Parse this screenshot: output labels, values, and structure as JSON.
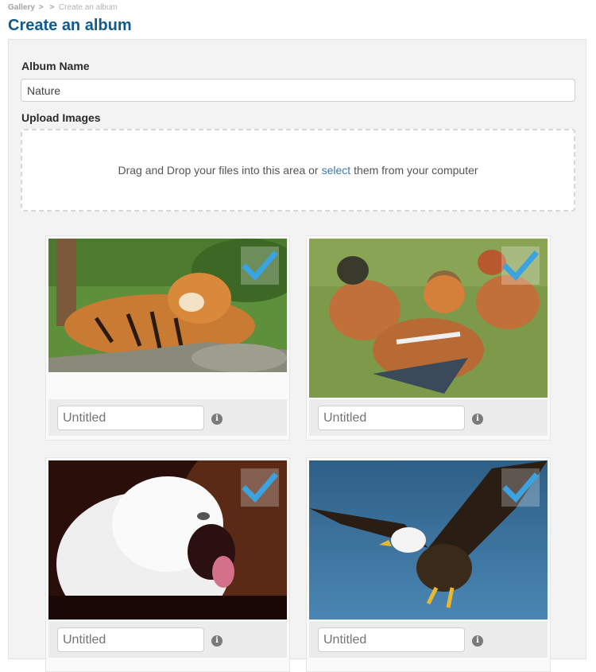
{
  "breadcrumb": {
    "root": "Gallery",
    "separator": ">",
    "current": "Create an album"
  },
  "page_title": "Create an album",
  "form": {
    "album_name_label": "Album Name",
    "album_name_value": "Nature",
    "upload_label": "Upload Images",
    "dropzone": {
      "text_before": "Drag and Drop your files into this area or",
      "link_text": "select",
      "text_after": "them from your computer"
    }
  },
  "images": [
    {
      "subject": "tigers",
      "title_placeholder": "Untitled",
      "selected": true,
      "info_icon": "info-icon",
      "check_icon": "checkmark-icon"
    },
    {
      "subject": "mandarin ducks",
      "title_placeholder": "Untitled",
      "selected": true,
      "info_icon": "info-icon",
      "check_icon": "checkmark-icon"
    },
    {
      "subject": "white lion",
      "title_placeholder": "Untitled",
      "selected": true,
      "info_icon": "info-icon",
      "check_icon": "checkmark-icon"
    },
    {
      "subject": "bald eagle",
      "title_placeholder": "Untitled",
      "selected": true,
      "info_icon": "info-icon",
      "check_icon": "checkmark-icon"
    }
  ],
  "info_glyph": "i",
  "colors": {
    "title_blue": "#0f5a8f",
    "link_blue": "#3a78b5",
    "check_blue": "#3aa3e0",
    "panel_bg": "#f3f3f3"
  }
}
